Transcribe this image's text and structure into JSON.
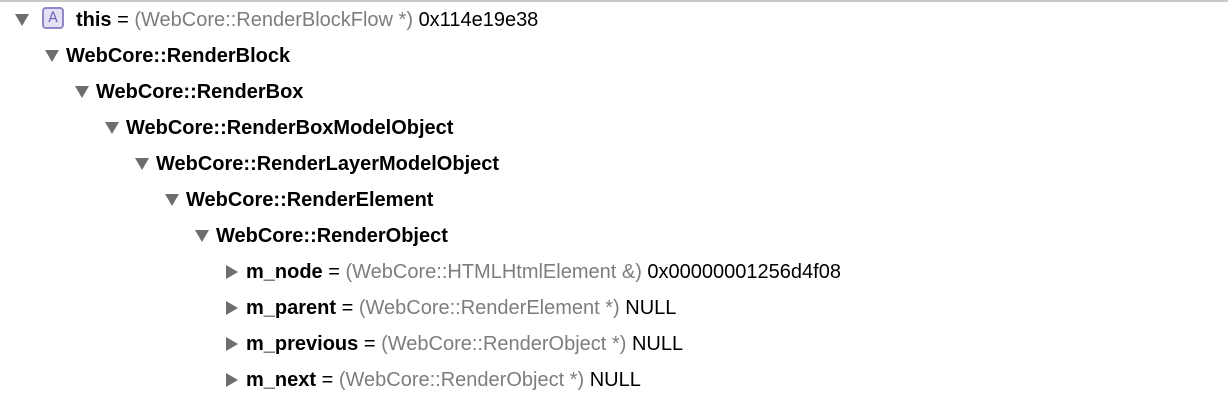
{
  "colors": {
    "badge_border": "#8f87c9",
    "badge_fill": "#e4e1f4",
    "badge_text": "#6a62b5",
    "type_text": "#7d7d7d",
    "disclosure": "#6e6e6e"
  },
  "tree": {
    "root": {
      "badge": "A",
      "name": "this",
      "eq": "=",
      "type": "(WebCore::RenderBlockFlow *)",
      "value": "0x114e19e38",
      "expanded": true
    },
    "bases": [
      {
        "name": "WebCore::RenderBlock",
        "expanded": true
      },
      {
        "name": "WebCore::RenderBox",
        "expanded": true
      },
      {
        "name": "WebCore::RenderBoxModelObject",
        "expanded": true
      },
      {
        "name": "WebCore::RenderLayerModelObject",
        "expanded": true
      },
      {
        "name": "WebCore::RenderElement",
        "expanded": true
      },
      {
        "name": "WebCore::RenderObject",
        "expanded": true
      }
    ],
    "members": [
      {
        "name": "m_node",
        "eq": "=",
        "type": "(WebCore::HTMLHtmlElement &)",
        "value": "0x00000001256d4f08",
        "expanded": false
      },
      {
        "name": "m_parent",
        "eq": "=",
        "type": "(WebCore::RenderElement *)",
        "value": "NULL",
        "expanded": false
      },
      {
        "name": "m_previous",
        "eq": "=",
        "type": "(WebCore::RenderObject *)",
        "value": "NULL",
        "expanded": false
      },
      {
        "name": "m_next",
        "eq": "=",
        "type": "(WebCore::RenderObject *)",
        "value": "NULL",
        "expanded": false
      }
    ]
  }
}
